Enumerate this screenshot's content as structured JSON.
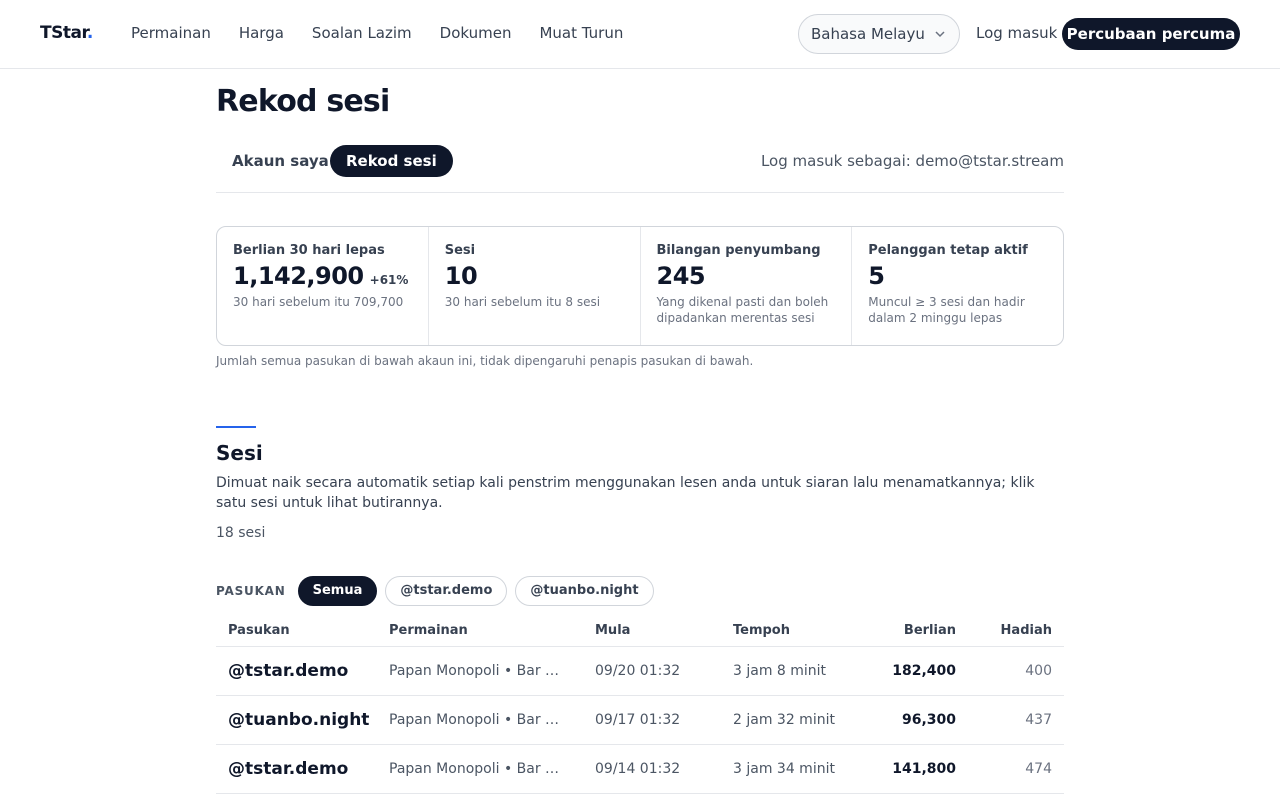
{
  "nav": {
    "brand": "TStar",
    "brand_dot": ".",
    "links": [
      "Permainan",
      "Harga",
      "Soalan Lazim",
      "Dokumen",
      "Muat Turun"
    ],
    "language": "Bahasa Melayu",
    "login": "Log masuk",
    "trial": "Percubaan percuma"
  },
  "page": {
    "title": "Rekod sesi",
    "tabs": [
      "Akaun saya",
      "Rekod sesi"
    ],
    "logged_in_as": "Log masuk sebagai: demo@tstar.stream"
  },
  "stats": [
    {
      "label": "Berlian 30 hari lepas",
      "value": "1,142,900",
      "delta": "+61%",
      "sub": "30 hari sebelum itu 709,700"
    },
    {
      "label": "Sesi",
      "value": "10",
      "delta": "",
      "sub": "30 hari sebelum itu 8 sesi"
    },
    {
      "label": "Bilangan penyumbang",
      "value": "245",
      "delta": "",
      "sub": "Yang dikenal pasti dan boleh dipadankan merentas sesi"
    },
    {
      "label": "Pelanggan tetap aktif",
      "value": "5",
      "delta": "",
      "sub": "Muncul ≥ 3 sesi dan hadir dalam 2 minggu lepas"
    }
  ],
  "stats_note": "Jumlah semua pasukan di bawah akaun ini, tidak dipengaruhi penapis pasukan di bawah.",
  "sessions": {
    "title": "Sesi",
    "description": "Dimuat naik secara automatik setiap kali penstrim menggunakan lesen anda untuk siaran lalu menamatkannya; klik satu sesi untuk lihat butirannya.",
    "count": "18 sesi",
    "filter_label": "PASUKAN",
    "filters": [
      "Semua",
      "@tstar.demo",
      "@tuanbo.night"
    ],
    "columns": [
      "Pasukan",
      "Permainan",
      "Mula",
      "Tempoh",
      "Berlian",
      "Hadiah"
    ],
    "rows": [
      {
        "team": "@tstar.demo",
        "game": "Papan Monopoli • Bar D…",
        "start": "09/20 01:32",
        "duration": "3 jam 8 minit",
        "diamonds": "182,400",
        "gifts": "400"
      },
      {
        "team": "@tuanbo.night",
        "game": "Papan Monopoli • Bar D…",
        "start": "09/17 01:32",
        "duration": "2 jam 32 minit",
        "diamonds": "96,300",
        "gifts": "437"
      },
      {
        "team": "@tstar.demo",
        "game": "Papan Monopoli • Bar D…",
        "start": "09/14 01:32",
        "duration": "3 jam 34 minit",
        "diamonds": "141,800",
        "gifts": "474"
      }
    ]
  }
}
